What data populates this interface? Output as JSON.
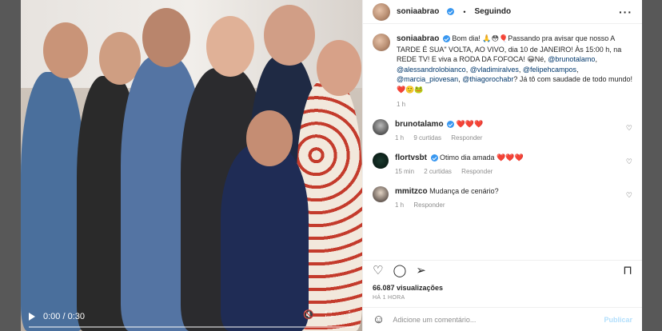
{
  "post": {
    "author": "soniaabrao",
    "follow_status": "Seguindo",
    "caption_prefix": "Bom dia! 🙏😳🎈Passando pra avisar que nosso A TARDE É SUA\" VOLTA, AO VIVO, dia 10 de JANEIRO! Às 15:00 h, na REDE TV! E viva a RODA DA FOFOCA! 😀Né, ",
    "mentions": [
      "@brunotalamo",
      "@alessandrolobianco",
      "@vladimiralves",
      "@felipehcampos",
      "@marcia_piovesan",
      "@thiagorochabr"
    ],
    "caption_suffix": "? Já tô com saudade de todo mundo!❤️🙂🐸",
    "caption_time": "1 h"
  },
  "comments": [
    {
      "user": "brunotalamo",
      "verified": true,
      "text": "❤️❤️❤️",
      "time": "1 h",
      "likes": "9 curtidas",
      "reply": "Responder"
    },
    {
      "user": "flortvsbt",
      "verified": true,
      "text": "Otimo dia amada ❤️❤️❤️",
      "time": "15 min",
      "likes": "2 curtidas",
      "reply": "Responder"
    },
    {
      "user": "mmitzco",
      "verified": false,
      "text": "Mudança de cenário?",
      "time": "1 h",
      "likes": "",
      "reply": "Responder"
    }
  ],
  "stats": {
    "views": "66.087 visualizações",
    "posted": "HÁ 1 HORA"
  },
  "add_comment": {
    "placeholder": "Adicione um comentário...",
    "publish": "Publicar"
  },
  "video": {
    "time": "0:00 / 0:30",
    "progress": 0.0
  },
  "icons": {
    "like": "heart-icon",
    "comment": "comment-icon",
    "share": "share-icon",
    "save": "bookmark-icon",
    "emoji": "emoji-icon",
    "more": "more-options-icon"
  }
}
